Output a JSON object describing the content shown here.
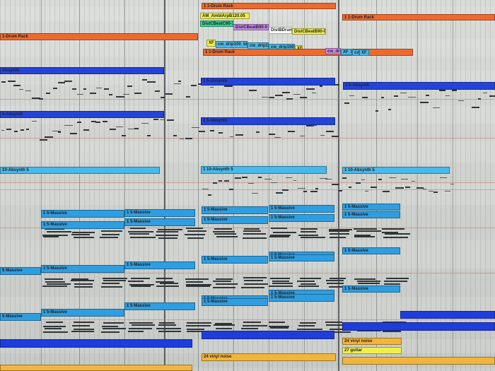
{
  "colors": {
    "drum_orange": "#ed6a2f",
    "absynth_blue": "#2444d8",
    "absynth_light": "#47b9ea",
    "massive_blue": "#2f9ee0",
    "bass_blue": "#1f3ddc",
    "noise_orange": "#f2b53c",
    "yellow": "#f0ef4a",
    "green": "#2fd492",
    "purple": "#c88ae8",
    "grid_bg": "#d4d6d2"
  },
  "clips": [
    {
      "id": "drum-rack-1",
      "label": "1 1-Drum Rack",
      "color": "#ed6a2f"
    },
    {
      "id": "drum-rack-2",
      "label": "1 1-Drum Rack",
      "color": "#ed6a2f"
    },
    {
      "id": "drum-rack-track",
      "label": "1-Drum Rack",
      "color": "#ed6a2f"
    },
    {
      "id": "ambi-arp",
      "label": "AM_AmbiArpB120.05",
      "color": "#f0ef4a"
    },
    {
      "id": "dist-beat-1",
      "label": "DistCBeatC90-1",
      "color": "#2fd492"
    },
    {
      "id": "dist-beat-2",
      "label": "DistCBeatB90-0",
      "color": "#c88ae8"
    },
    {
      "id": "dist-drums",
      "label": "DistBDrums",
      "color": "#ffffff"
    },
    {
      "id": "dist-beat-3",
      "label": "DistCBeatB90-0",
      "color": "#f0ef4a"
    },
    {
      "id": "xf-loop-1",
      "label": "XF_Loo",
      "color": "#f0ef4a"
    },
    {
      "id": "cw-drip-1",
      "label": "cw_drip100_bit",
      "color": "#47b9ea"
    },
    {
      "id": "cw-drip-2",
      "label": "cw_drip100",
      "color": "#47b9ea"
    },
    {
      "id": "cw-drip-3",
      "label": "cw_drip100",
      "color": "#47b9ea"
    },
    {
      "id": "xf-loop-2",
      "label": "XF",
      "color": "#f0ef4a"
    },
    {
      "id": "drum-rack-3",
      "label": "1 1-Drum Rack",
      "color": "#ed6a2f"
    },
    {
      "id": "cw-drip-4",
      "label": "cw_drip",
      "color": "#c88ae8"
    },
    {
      "id": "xf-loop-3",
      "label": "XF_Loo",
      "color": "#47b9ea"
    },
    {
      "id": "cw-5",
      "label": "cw",
      "color": "#47b9ea"
    },
    {
      "id": "xf-loop-4",
      "label": "XF_Loo",
      "color": "#47b9ea"
    },
    {
      "id": "absynth-track",
      "label": "Absynth",
      "color": "#2444d8"
    },
    {
      "id": "absynth-1",
      "label": "1 5-Absynth",
      "color": "#2444d8"
    },
    {
      "id": "absynth-2",
      "label": "1 5-Absynth",
      "color": "#2444d8"
    },
    {
      "id": "absynth-track-2",
      "label": "5-Absynth",
      "color": "#2444d8"
    },
    {
      "id": "absynth-3",
      "label": "1 5-Absynth",
      "color": "#2444d8"
    },
    {
      "id": "absynth10-track",
      "label": "10-Absynth 5",
      "color": "#47b9ea"
    },
    {
      "id": "absynth10-1",
      "label": "1 10-Absynth 5",
      "color": "#47b9ea"
    },
    {
      "id": "absynth10-2",
      "label": "1 10-Absynth 5",
      "color": "#47b9ea"
    },
    {
      "id": "massive-a1",
      "label": "1 5-Massive",
      "color": "#2f9ee0"
    },
    {
      "id": "massive-a2",
      "label": "1 5-Massive",
      "color": "#2f9ee0"
    },
    {
      "id": "massive-a3",
      "label": "1 5-Massive",
      "color": "#2f9ee0"
    },
    {
      "id": "massive-a4",
      "label": "1 5-Massive",
      "color": "#2f9ee0"
    },
    {
      "id": "massive-a5",
      "label": "1 5-Massive",
      "color": "#2f9ee0"
    },
    {
      "id": "massive-b1",
      "label": "1 5-Massive",
      "color": "#2f9ee0"
    },
    {
      "id": "massive-b2",
      "label": "1 5-Massive",
      "color": "#2f9ee0"
    },
    {
      "id": "massive-b3",
      "label": "1 5-Massive",
      "color": "#2f9ee0"
    },
    {
      "id": "massive-b4",
      "label": "1 5-Massive",
      "color": "#2f9ee0"
    },
    {
      "id": "massive-b5",
      "label": "1 5-Massive",
      "color": "#2f9ee0"
    },
    {
      "id": "massive-c3",
      "label": "1 5-Massive",
      "color": "#2f9ee0"
    },
    {
      "id": "massive-c4",
      "label": "1 5-Massive",
      "color": "#2f9ee0"
    },
    {
      "id": "massive-c5",
      "label": "1 5-Massive",
      "color": "#2f9ee0"
    },
    {
      "id": "massive-d0",
      "label": "5-Massive",
      "color": "#2f9ee0"
    },
    {
      "id": "massive-d1",
      "label": "1 5-Massive",
      "color": "#2f9ee0"
    },
    {
      "id": "massive-d2",
      "label": "1 5-Massive",
      "color": "#2f9ee0"
    },
    {
      "id": "massive-d3",
      "label": "1 5-Massive",
      "color": "#2f9ee0"
    },
    {
      "id": "massive-d4",
      "label": "1 5-Massive",
      "color": "#2f9ee0"
    },
    {
      "id": "massive-d4b",
      "label": "1 5-Massive",
      "color": "#2f9ee0"
    },
    {
      "id": "massive-d5",
      "label": "1 5-Massive",
      "color": "#2f9ee0"
    },
    {
      "id": "massive-e0",
      "label": "5-Massive",
      "color": "#2f9ee0"
    },
    {
      "id": "massive-e1",
      "label": "1 5-Massive",
      "color": "#2f9ee0"
    },
    {
      "id": "massive-e2",
      "label": "1 5-Massive",
      "color": "#2f9ee0"
    },
    {
      "id": "massive-e3",
      "label": "1 5-Massive",
      "color": "#2f9ee0"
    },
    {
      "id": "massive-e4",
      "label": "1 5-Massive",
      "color": "#2f9ee0"
    },
    {
      "id": "bass-1",
      "label": "",
      "color": "#1f3ddc"
    },
    {
      "id": "bass-2",
      "label": "",
      "color": "#1f3ddc"
    },
    {
      "id": "bass-3",
      "label": "",
      "color": "#1f3ddc"
    },
    {
      "id": "bass-4",
      "label": "",
      "color": "#1f3ddc"
    },
    {
      "id": "vinyl-noise-1",
      "label": "24 vinyl noise",
      "color": "#f2b53c"
    },
    {
      "id": "vinyl-noise-2",
      "label": "24 vinyl noise",
      "color": "#f2b53c"
    },
    {
      "id": "guitar",
      "label": "27 guitar",
      "color": "#f0ef4a"
    },
    {
      "id": "bottom-1",
      "label": "",
      "color": "#f2b53c"
    },
    {
      "id": "bottom-2",
      "label": "",
      "color": "#f2b53c"
    }
  ]
}
